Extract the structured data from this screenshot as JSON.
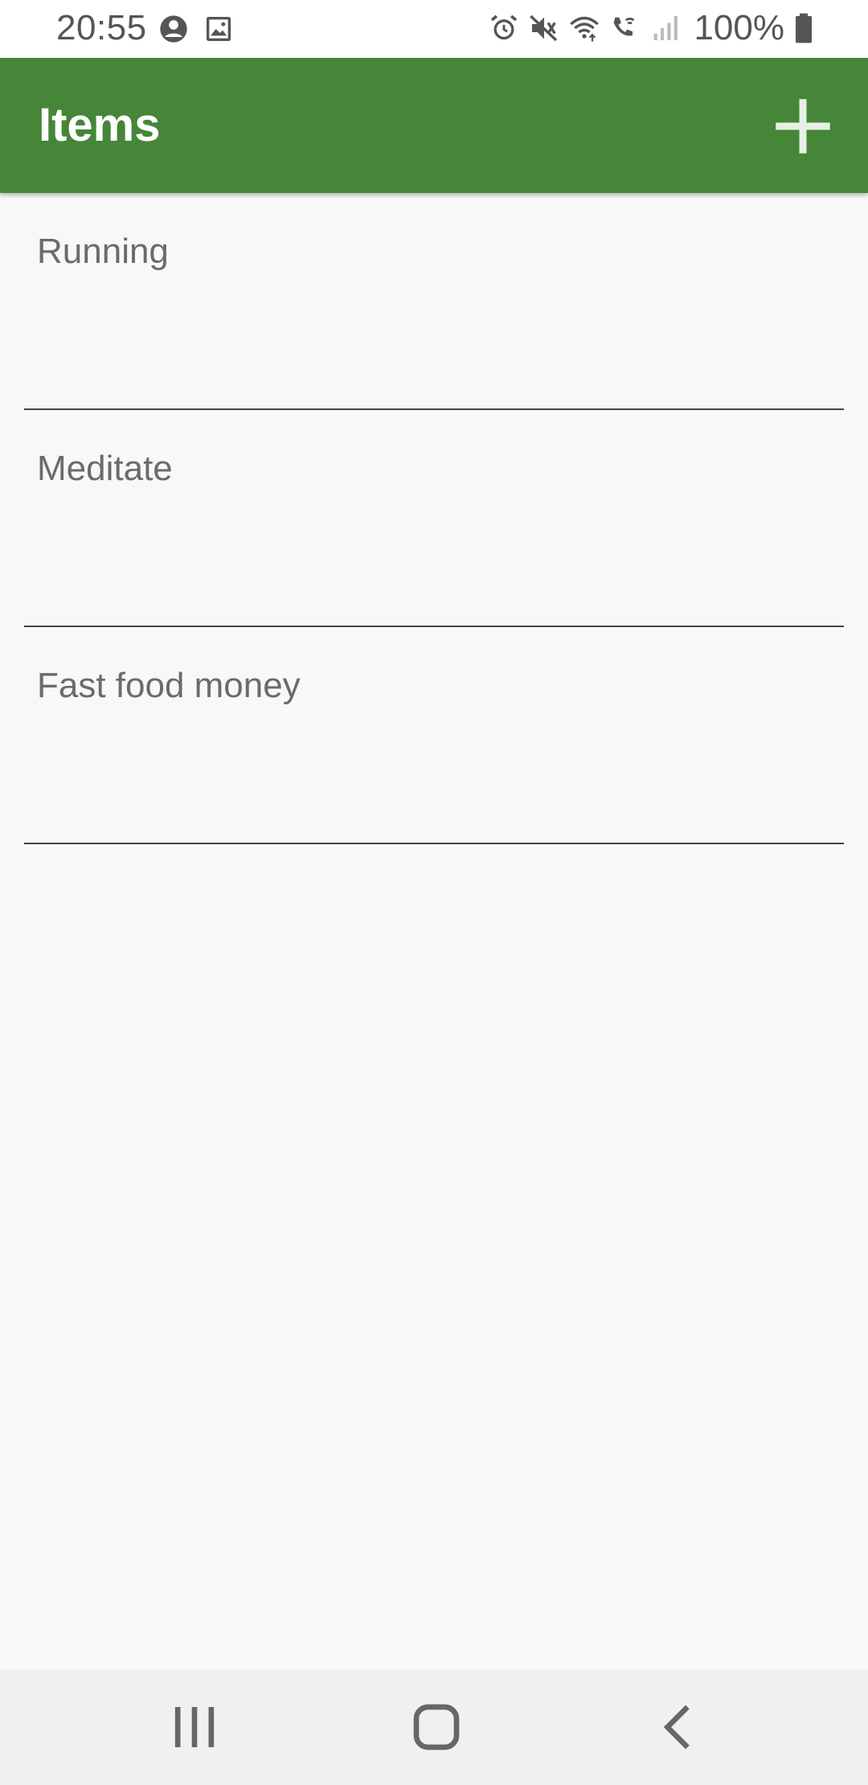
{
  "status_bar": {
    "time": "20:55",
    "left_icons": [
      "account-circle-icon",
      "image-icon"
    ],
    "right_icons": [
      "alarm-icon",
      "mute-icon",
      "wifi-icon",
      "wifi-calling-icon",
      "signal-icon"
    ],
    "battery": "100%"
  },
  "app_bar": {
    "title": "Items",
    "add_icon": "plus-icon",
    "color": "#458638"
  },
  "items": [
    {
      "label": "Running"
    },
    {
      "label": "Meditate"
    },
    {
      "label": "Fast food money"
    }
  ],
  "nav_bar": {
    "recents_icon": "recents-icon",
    "home_icon": "home-icon",
    "back_icon": "back-icon"
  }
}
